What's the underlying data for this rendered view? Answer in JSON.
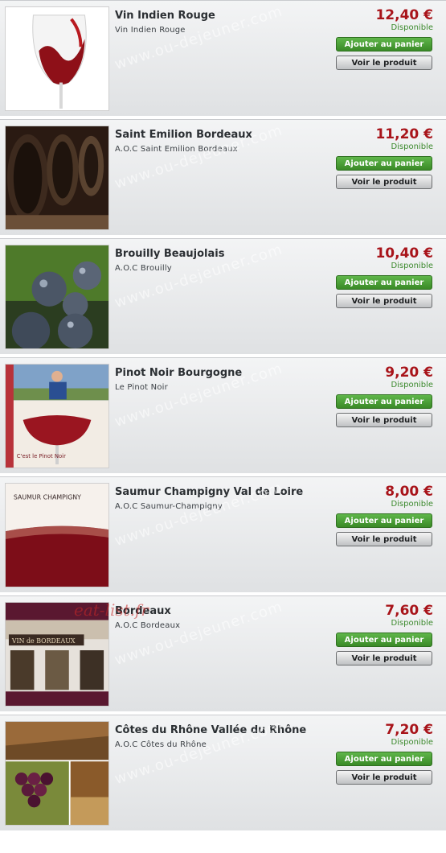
{
  "products": [
    {
      "title": "Vin Indien Rouge",
      "subtitle": "Vin Indien Rouge",
      "price": "12,40 €",
      "availability": "Disponible",
      "add_label": "Ajouter au panier",
      "view_label": "Voir le produit",
      "image": "red-wine-glass-photo"
    },
    {
      "title": "Saint Emilion Bordeaux",
      "subtitle": "A.O.C Saint Emilion Bordeaux",
      "price": "11,20 €",
      "availability": "Disponible",
      "add_label": "Ajouter au panier",
      "view_label": "Voir le produit",
      "image": "wine-bottles-cellar-photo"
    },
    {
      "title": "Brouilly Beaujolais",
      "subtitle": "A.O.C Brouilly",
      "price": "10,40 €",
      "availability": "Disponible",
      "add_label": "Ajouter au panier",
      "view_label": "Voir le produit",
      "image": "grapes-closeup-photo"
    },
    {
      "title": "Pinot Noir Bourgogne",
      "subtitle": "Le Pinot Noir",
      "price": "9,20 €",
      "availability": "Disponible",
      "add_label": "Ajouter au panier",
      "view_label": "Voir le produit",
      "image": "bourgogne-poster-photo"
    },
    {
      "title": "Saumur Champigny Val de Loire",
      "subtitle": "A.O.C Saumur-Champigny",
      "price": "8,00 €",
      "availability": "Disponible",
      "add_label": "Ajouter au panier",
      "view_label": "Voir le produit",
      "image": "saumur-wine-glass-photo"
    },
    {
      "title": "Bordeaux",
      "subtitle": "A.O.C Bordeaux",
      "price": "7,60 €",
      "availability": "Disponible",
      "add_label": "Ajouter au panier",
      "view_label": "Voir le produit",
      "image": "bordeaux-storefront-photo"
    },
    {
      "title": "Côtes du Rhône Vallée du Rhône",
      "subtitle": "A.O.C Côtes du Rhône",
      "price": "7,20 €",
      "availability": "Disponible",
      "add_label": "Ajouter au panier",
      "view_label": "Voir le produit",
      "image": "vineyard-collage-photo"
    }
  ],
  "watermark": "www.ou-dejeuner.com",
  "stamp": "eat-list.fr",
  "thumb_texts": {
    "pinot_poster": "C'est le Pinot Noir",
    "saumur_label": "SAUMUR CHAMPIGNY",
    "bordeaux_sign": "VIN de BORDEAUX"
  },
  "colors": {
    "price": "#a8141a",
    "availability": "#3d8a2e",
    "add_button": "#4aa037",
    "view_button": "#d6d7d8"
  }
}
